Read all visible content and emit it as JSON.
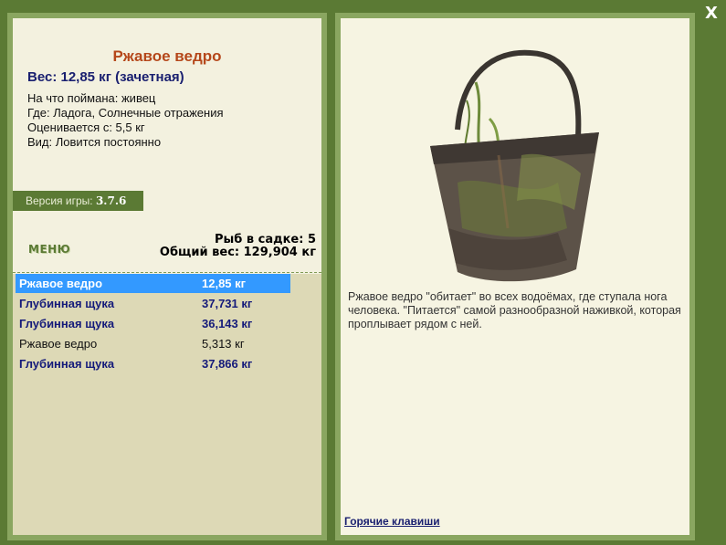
{
  "item": {
    "title": "Ржавое ведро",
    "weight": "Вес: 12,85 кг (зачетная)",
    "info_lines": [
      "На что поймана: живец",
      "Где: Ладога, Солнечные отражения",
      "Оценивается с: 5,5 кг",
      "Вид: Ловится постоянно"
    ]
  },
  "version": {
    "label": "Версия игры:",
    "value": "3.7.6"
  },
  "menu_label": "МЕНЮ",
  "stats": {
    "count": "Рыб в садке: 5",
    "total": "Общий вес: 129,904 кг"
  },
  "catch_list": [
    {
      "name": "Ржавое ведро",
      "weight": "12,85 кг",
      "style": "selected"
    },
    {
      "name": "Глубинная щука",
      "weight": "37,731 кг",
      "style": "bold"
    },
    {
      "name": "Глубинная щука",
      "weight": "36,143 кг",
      "style": "bold"
    },
    {
      "name": "Ржавое ведро",
      "weight": "5,313 кг",
      "style": "plain"
    },
    {
      "name": "Глубинная щука",
      "weight": "37,866 кг",
      "style": "bold"
    }
  ],
  "description": "Ржавое ведро \"обитает\" во всех водоёмах, где ступала нога человека. \"Питается\" самой разнообразной наживкой, которая проплывает рядом с ней.",
  "hotkeys_label": "Горячие клавиши",
  "close_label": "X",
  "colors": {
    "background": "#5b7a34",
    "panel_border": "#8aa660",
    "panel_fill": "#f3f1df",
    "list_fill": "#ddd9b6",
    "title": "#b5471a",
    "selected_row": "#3399ff",
    "bold_row_text": "#141a7a"
  }
}
